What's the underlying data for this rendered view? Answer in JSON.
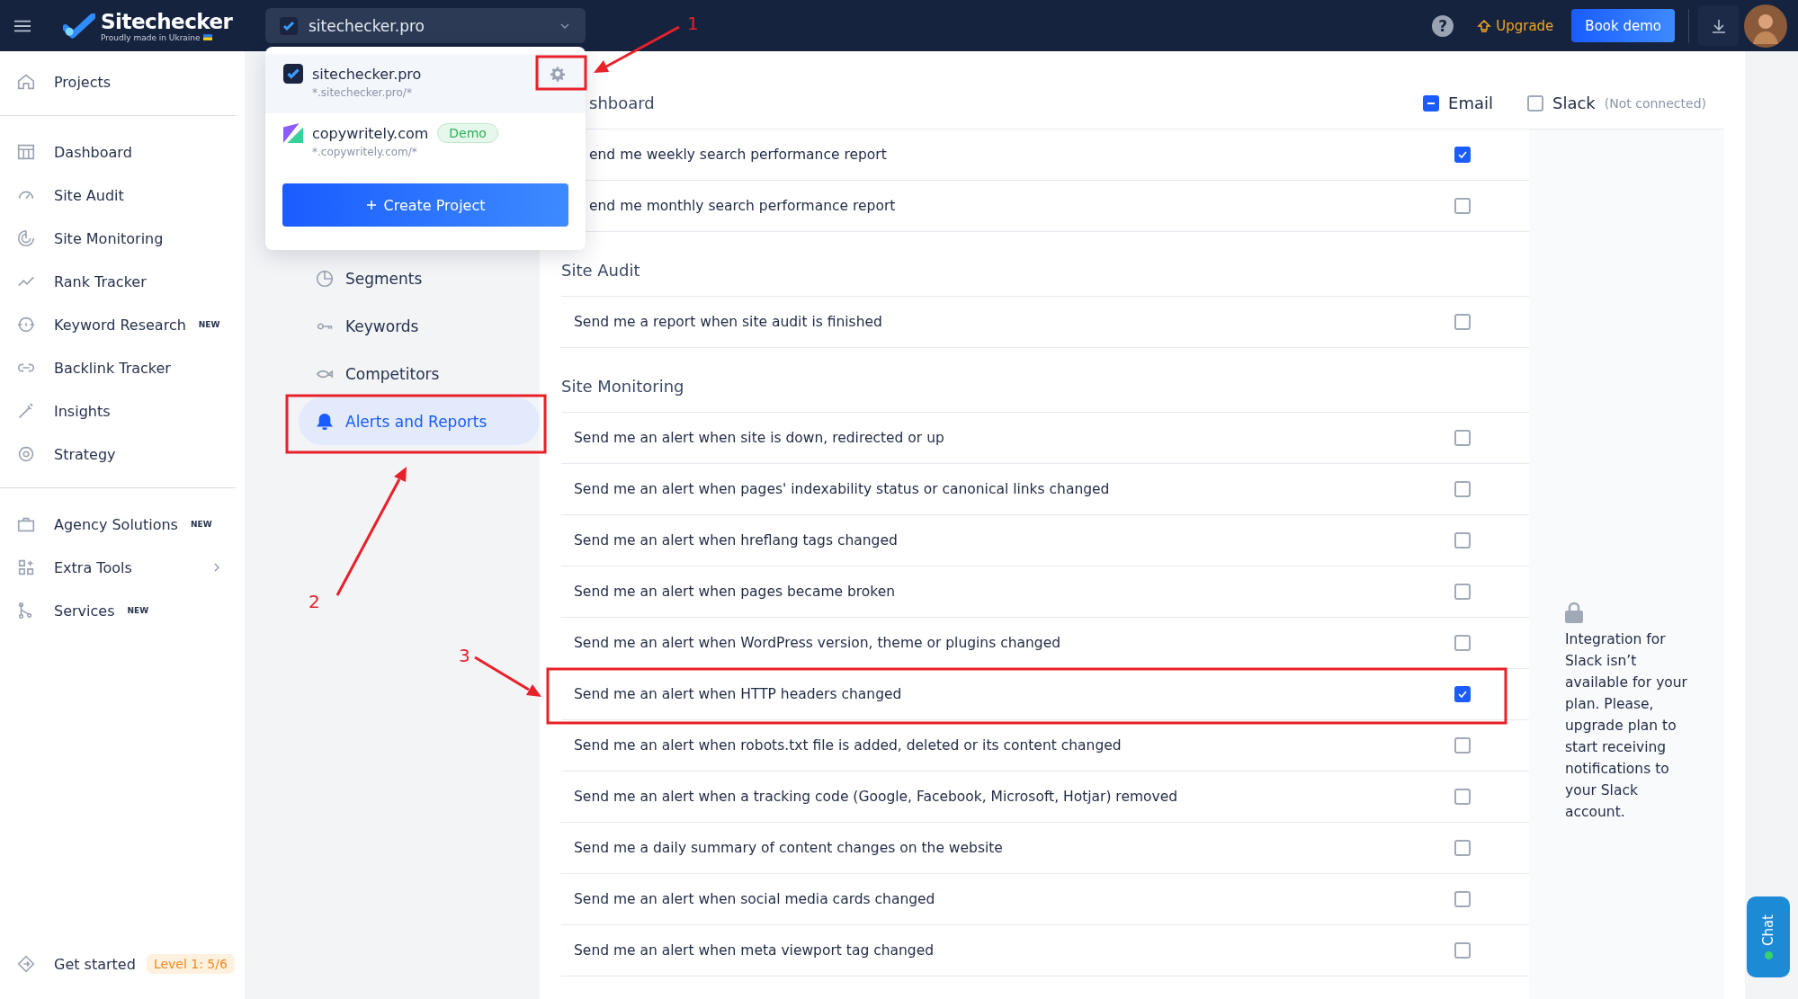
{
  "topbar": {
    "brand": "Sitechecker",
    "tagline": "Proudly made in Ukraine",
    "project": "sitechecker.pro",
    "help": "?",
    "upgrade": "Upgrade",
    "book_demo": "Book demo"
  },
  "sidebar": {
    "groups": [
      [
        {
          "label": "Projects",
          "submenu": false
        }
      ],
      [
        {
          "label": "Dashboard",
          "submenu": false
        },
        {
          "label": "Site Audit",
          "submenu": false
        },
        {
          "label": "Site Monitoring",
          "submenu": false
        },
        {
          "label": "Rank Tracker",
          "submenu": false
        },
        {
          "label": "Keyword Research",
          "badge": "NEW",
          "submenu": false
        },
        {
          "label": "Backlink Tracker",
          "submenu": false
        },
        {
          "label": "Insights",
          "submenu": false
        },
        {
          "label": "Strategy",
          "submenu": false
        }
      ],
      [
        {
          "label": "Agency Solutions",
          "badge": "NEW",
          "submenu": false
        },
        {
          "label": "Extra Tools",
          "submenu": true
        },
        {
          "label": "Services",
          "badge": "NEW",
          "submenu": false
        }
      ]
    ],
    "footer": {
      "label": "Get started",
      "badge": "Level 1: 5/6"
    }
  },
  "subnav": [
    {
      "label": "Segments",
      "selected": false
    },
    {
      "label": "Keywords",
      "selected": false
    },
    {
      "label": "Competitors",
      "selected": false
    },
    {
      "label": "Alerts and Reports",
      "selected": true
    }
  ],
  "dropdown": {
    "projects": [
      {
        "name": "sitechecker.pro",
        "pattern": "*.sitechecker.pro/*",
        "selected": true
      },
      {
        "name": "copywritely.com",
        "pattern": "*.copywritely.com/*",
        "badge": "Demo",
        "selected": false
      }
    ],
    "create": "Create Project"
  },
  "settings": {
    "columns": [
      {
        "label": "Email",
        "partial": true
      },
      {
        "label": "Slack",
        "note": "(Not connected)",
        "partial": false
      }
    ],
    "sections": [
      {
        "title": "shboard",
        "partly_hidden": true,
        "rows": [
          {
            "label": "end me weekly search performance report",
            "checked": true,
            "partly_hidden": true
          },
          {
            "label": "end me monthly search performance report",
            "checked": false,
            "partly_hidden": true
          }
        ]
      },
      {
        "title": "Site Audit",
        "partly_hidden": false,
        "rows": [
          {
            "label": "Send me a report when site audit is finished",
            "checked": false,
            "partly_hidden": false
          }
        ]
      },
      {
        "title": "Site Monitoring",
        "partly_hidden": false,
        "rows": [
          {
            "label": "Send me an alert when site is down, redirected or up",
            "checked": false,
            "partly_hidden": false
          },
          {
            "label": "Send me an alert when pages' indexability status or canonical links changed",
            "checked": false,
            "partly_hidden": false
          },
          {
            "label": "Send me an alert when hreflang tags changed",
            "checked": false,
            "partly_hidden": false
          },
          {
            "label": "Send me an alert when pages became broken",
            "checked": false,
            "partly_hidden": false
          },
          {
            "label": "Send me an alert when WordPress version, theme or plugins changed",
            "checked": false,
            "partly_hidden": false
          },
          {
            "label": "Send me an alert when HTTP headers changed",
            "checked": true,
            "partly_hidden": false
          },
          {
            "label": "Send me an alert when robots.txt file is added, deleted or its content changed",
            "checked": false,
            "partly_hidden": false
          },
          {
            "label": "Send me an alert when a tracking code (Google, Facebook, Microsoft, Hotjar) removed",
            "checked": false,
            "partly_hidden": false
          },
          {
            "label": "Send me a daily summary of content changes on the website",
            "checked": false,
            "partly_hidden": false
          },
          {
            "label": "Send me an alert when social media cards changed",
            "checked": false,
            "partly_hidden": false
          },
          {
            "label": "Send me an alert when meta viewport tag changed",
            "checked": false,
            "partly_hidden": false
          }
        ]
      }
    ],
    "slack_notice": "Integration for Slack isn’t available for your plan. Please, upgrade plan to start receiving notifications to your Slack account."
  },
  "annotations": [
    {
      "label": "1"
    },
    {
      "label": "2"
    },
    {
      "label": "3"
    }
  ],
  "chat": "Chat"
}
